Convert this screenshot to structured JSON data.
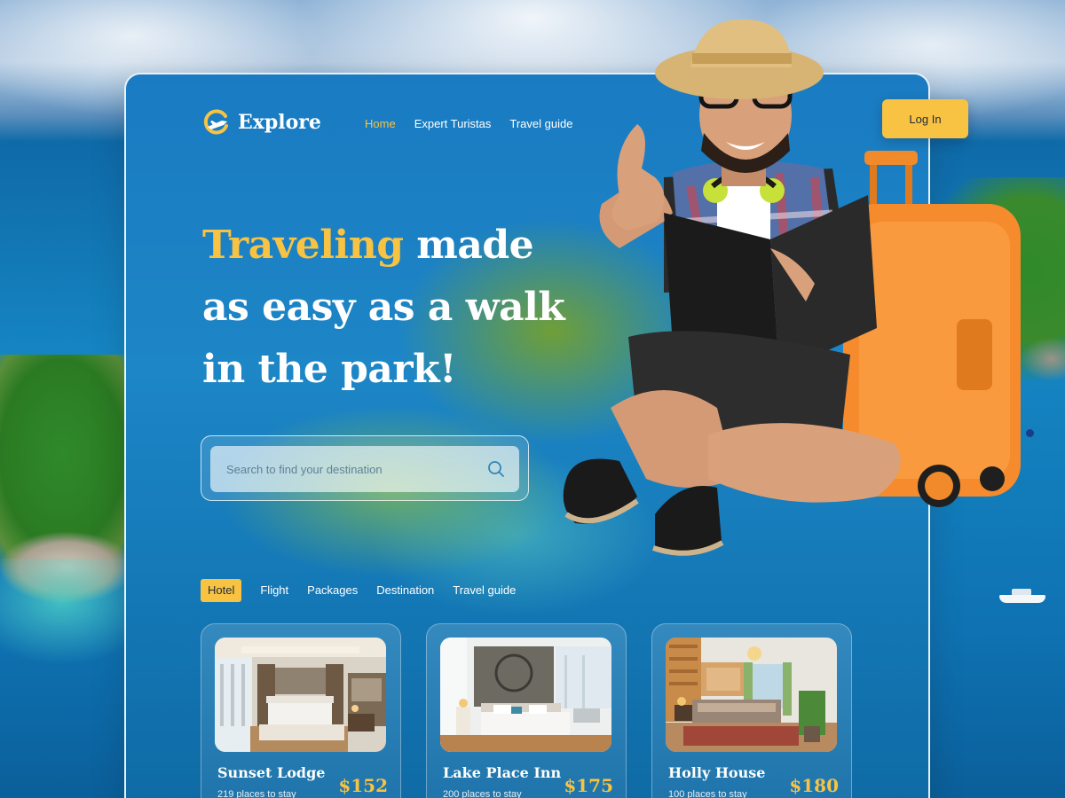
{
  "brand": {
    "name": "Explore"
  },
  "nav": {
    "links": [
      {
        "label": "Home",
        "active": true
      },
      {
        "label": "Expert Turistas",
        "active": false
      },
      {
        "label": "Travel guide",
        "active": false
      }
    ],
    "login_label": "Log In"
  },
  "hero": {
    "highlight": "Traveling",
    "line1_rest": " made",
    "line2": "as easy as a walk",
    "line3": "in the park!"
  },
  "search": {
    "placeholder": "Search to find your destination"
  },
  "tabs": [
    {
      "label": "Hotel",
      "active": true
    },
    {
      "label": "Flight",
      "active": false
    },
    {
      "label": "Packages",
      "active": false
    },
    {
      "label": "Destination",
      "active": false
    },
    {
      "label": "Travel guide",
      "active": false
    }
  ],
  "hotels": [
    {
      "name": "Sunset Lodge",
      "places": "219 places to stay",
      "price": "$152"
    },
    {
      "name": "Lake Place Inn",
      "places": "200 places to stay",
      "price": "$175"
    },
    {
      "name": "Holly House",
      "places": "100 places to stay",
      "price": "$180"
    }
  ],
  "colors": {
    "accent": "#f8c343",
    "text_light": "#ffffff",
    "ocean": "#1585c2"
  },
  "icons": {
    "logo": "plane-sun-logo-icon",
    "search": "search-icon"
  }
}
